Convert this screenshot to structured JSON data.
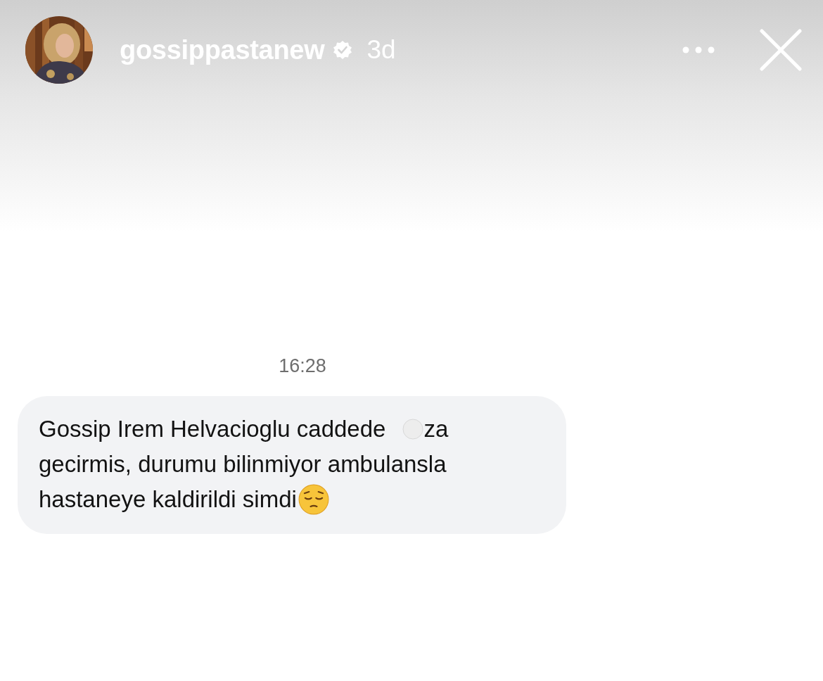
{
  "story": {
    "username": "gossippastanew",
    "verified": true,
    "age": "3d"
  },
  "message": {
    "time": "16:28",
    "lines": [
      {
        "kind": "covered",
        "parts": [
          "Gossip Irem Helvacioglu caddede",
          "za"
        ]
      },
      {
        "kind": "plain",
        "parts": [
          "gecirmis, durumu bilinmiyor ambulansla"
        ]
      },
      {
        "kind": "emoji",
        "parts": [
          "hastaneye kaldirildi simdi"
        ]
      }
    ]
  }
}
